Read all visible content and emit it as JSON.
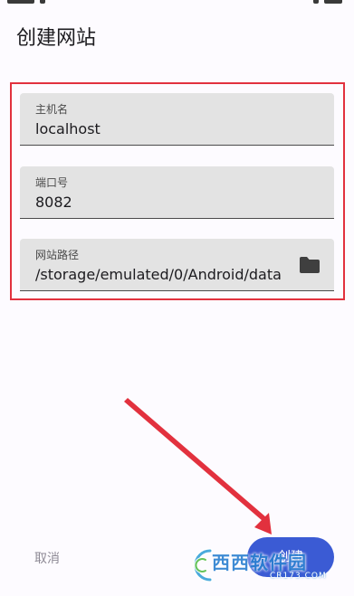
{
  "page": {
    "title": "创建网站"
  },
  "form": {
    "host": {
      "label": "主机名",
      "value": "localhost"
    },
    "port": {
      "label": "端口号",
      "value": "8082"
    },
    "path": {
      "label": "网站路径",
      "value": "/storage/emulated/0/Android/data"
    }
  },
  "actions": {
    "cancel_label": "取消",
    "create_label": "创建"
  },
  "icons": {
    "folder": "folder-icon"
  },
  "watermark": {
    "brand": "西西软件园",
    "domain": "CR173.COM"
  },
  "colors": {
    "annotation_red": "#e2313e",
    "primary": "#3b5bd4",
    "field_bg": "#e3e3e3",
    "page_bg": "#fdfbff"
  }
}
